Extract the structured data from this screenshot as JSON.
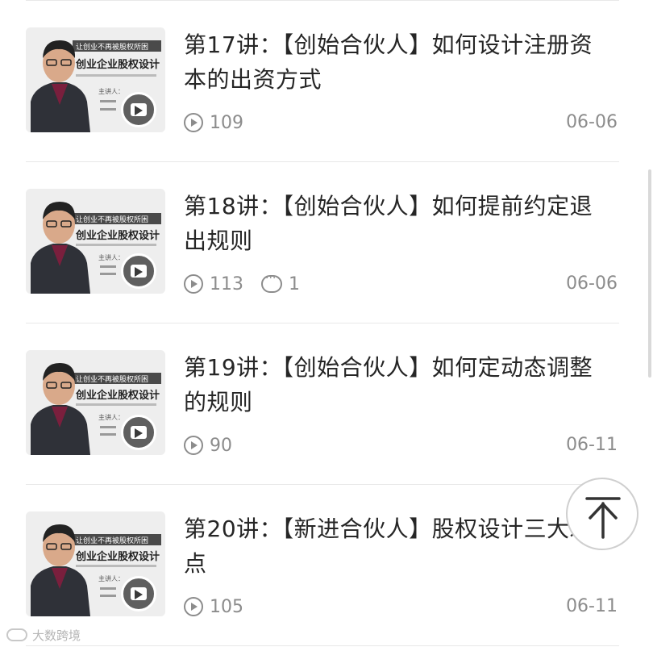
{
  "lessons": [
    {
      "title": "第17讲：【创始合伙人】如何设计注册资本的出资方式",
      "views": "109",
      "comments": "",
      "date": "06-06"
    },
    {
      "title": "第18讲：【创始合伙人】如何提前约定退出规则",
      "views": "113",
      "comments": "1",
      "date": "06-06"
    },
    {
      "title": "第19讲：【创始合伙人】如何定动态调整的规则",
      "views": "90",
      "comments": "",
      "date": "06-11"
    },
    {
      "title": "第20讲：【新进合伙人】股权设计三大难点",
      "views": "105",
      "comments": "",
      "date": "06-11"
    }
  ],
  "thumbnail": {
    "tagline": "让创业不再被股权所困",
    "headline": "创业企业股权设计",
    "lecturer_label": "主讲人：",
    "accent_color": "#7a1f3d"
  },
  "watermark": {
    "text": "大数跨境"
  },
  "back_to_top_icon": "arrow-up-icon"
}
